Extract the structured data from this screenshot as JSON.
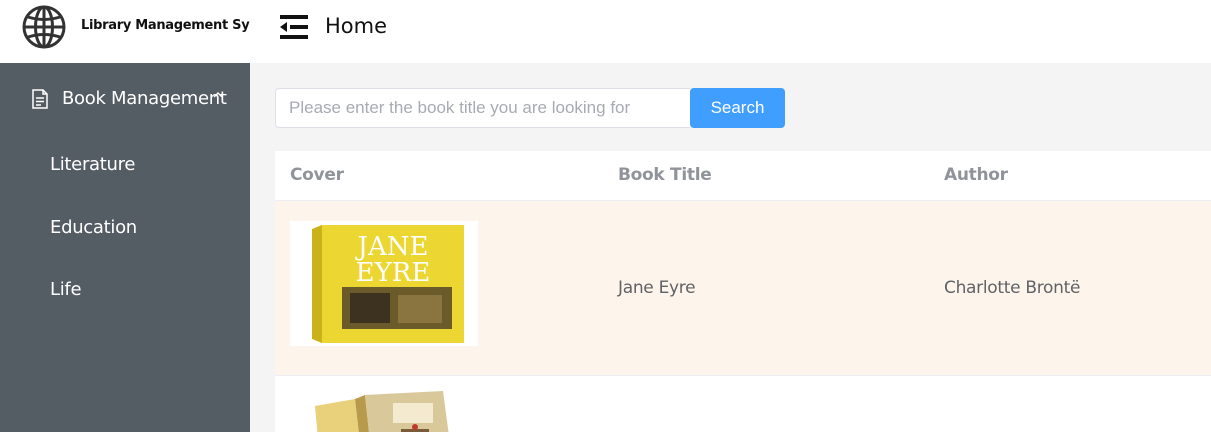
{
  "header": {
    "app_title": "Library Management System",
    "page_title": "Home",
    "logo_icon": "globe-icon",
    "collapse_icon": "menu-fold-icon"
  },
  "sidebar": {
    "group": {
      "label": "Book Management",
      "icon": "document-icon",
      "expanded": true
    },
    "items": [
      {
        "label": "Literature"
      },
      {
        "label": "Education"
      },
      {
        "label": "Life"
      }
    ],
    "colors": {
      "background": "#545c64",
      "text": "#ffffff"
    }
  },
  "search": {
    "placeholder": "Please enter the book title you are looking for",
    "value": "",
    "button_label": "Search"
  },
  "table": {
    "columns": [
      "Cover",
      "Book Title",
      "Author"
    ],
    "rows": [
      {
        "cover_text_1": "JANE",
        "cover_text_2": "EYRE",
        "title": "Jane Eyre",
        "author": "Charlotte Brontë"
      },
      {
        "title": "",
        "author": ""
      }
    ]
  },
  "colors": {
    "accent": "#409eff",
    "highlight_row": "#fdf5ec",
    "main_background": "#f4f4f4"
  }
}
